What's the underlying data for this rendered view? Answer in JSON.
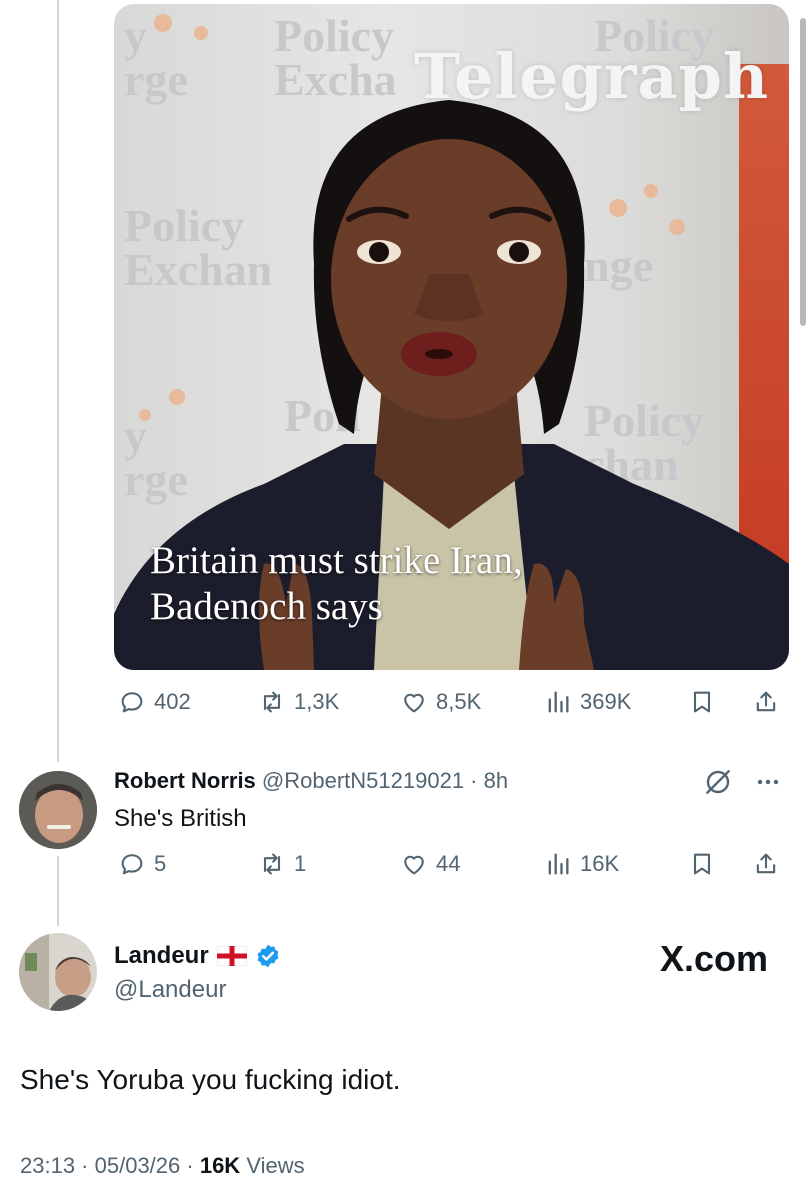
{
  "card": {
    "masthead": "Telegraph",
    "headline_line1": "Britain must strike Iran,",
    "headline_line2": "Badenoch says"
  },
  "quoted_tweet_actions": {
    "replies": "402",
    "retweets": "1,3K",
    "likes": "8,5K",
    "views": "369K"
  },
  "reply": {
    "name": "Robert Norris",
    "handle": "@RobertN51219021",
    "time": "8h",
    "text": "She's British",
    "replies": "5",
    "retweets": "1",
    "likes": "44",
    "views": "16K"
  },
  "main_tweet": {
    "name": "Landeur",
    "handle": "@Landeur",
    "watermark": "X.com",
    "text": "She's Yoruba you fucking idiot.",
    "time": "23:13",
    "date": "05/03/26",
    "views_count": "16K",
    "views_label": "Views"
  },
  "colors": {
    "text": "#0f1419",
    "muted": "#536471",
    "verified": "#1d9bf0",
    "thread_line": "#cfd9de"
  }
}
